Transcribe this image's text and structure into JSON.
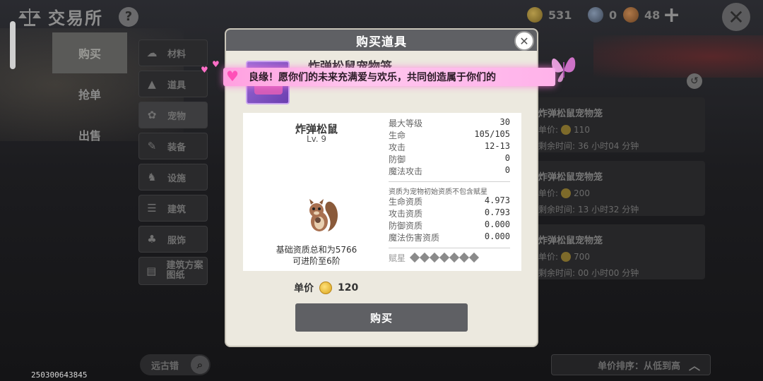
{
  "header": {
    "title": "交易所",
    "help_label": "?",
    "gold": "531",
    "silver": "0",
    "bronze": "48",
    "add_label": "+",
    "close_label": "✕"
  },
  "left_nav": {
    "items": [
      "购买",
      "抢单",
      "出售"
    ],
    "active_index": 0
  },
  "categories": [
    {
      "label": "材料",
      "icon": "material-icon"
    },
    {
      "label": "道具",
      "icon": "item-icon"
    },
    {
      "label": "宠物",
      "icon": "pet-paw-icon"
    },
    {
      "label": "装备",
      "icon": "equipment-icon"
    },
    {
      "label": "设施",
      "icon": "facility-icon"
    },
    {
      "label": "建筑",
      "icon": "building-icon"
    },
    {
      "label": "服饰",
      "icon": "clothing-icon"
    },
    {
      "label": "建筑方案图纸",
      "icon": "blueprint-icon"
    }
  ],
  "listings": [
    {
      "name": "炸弹松鼠宠物笼",
      "price_label": "单价:",
      "price": "110",
      "time_label": "剩余时间:",
      "time": "36 小时04 分钟"
    },
    {
      "name": "炸弹松鼠宠物笼",
      "price_label": "单价:",
      "price": "200",
      "time_label": "剩余时间:",
      "time": "13 小时32 分钟"
    },
    {
      "name": "炸弹松鼠宠物笼",
      "price_label": "单价:",
      "price": "700",
      "time_label": "剩余时间:",
      "time": "00 小时00 分钟"
    }
  ],
  "sort": {
    "label": "单价排序：从低到高"
  },
  "search": {
    "text": "远古错"
  },
  "uid": "250300643845",
  "modal": {
    "title": "购买道具",
    "item_name": "炸弹松鼠宠物笼",
    "pet_name": "炸弹松鼠",
    "pet_level": "Lv. 9",
    "stats": [
      {
        "label": "最大等级",
        "value": "30"
      },
      {
        "label": "生命",
        "value": "105/105"
      },
      {
        "label": "攻击",
        "value": "12-13"
      },
      {
        "label": "防御",
        "value": "0"
      },
      {
        "label": "魔法攻击",
        "value": "0"
      }
    ],
    "aptitude_note": "资质为宠物初始资质不包含赋星",
    "aptitudes": [
      {
        "label": "生命资质",
        "value": "4.973"
      },
      {
        "label": "攻击资质",
        "value": "0.793"
      },
      {
        "label": "防御资质",
        "value": "0.000"
      },
      {
        "label": "魔法伤害资质",
        "value": "0.000"
      }
    ],
    "talent_label": "赋星",
    "talent_count": 7,
    "base_sum": "基础资质总和为5766",
    "advance": "可进阶至6阶",
    "price_label": "单价",
    "price": "120",
    "buy_label": "购买"
  },
  "banner": {
    "text": "良缘！愿你们的未来充满爱与欢乐，共同创造属于你们的"
  },
  "colors": {
    "modal_bg": "#ece9df",
    "header_gray": "#5f6064",
    "banner_pink": "#ffb2ea",
    "gold": "#d9a21b"
  }
}
